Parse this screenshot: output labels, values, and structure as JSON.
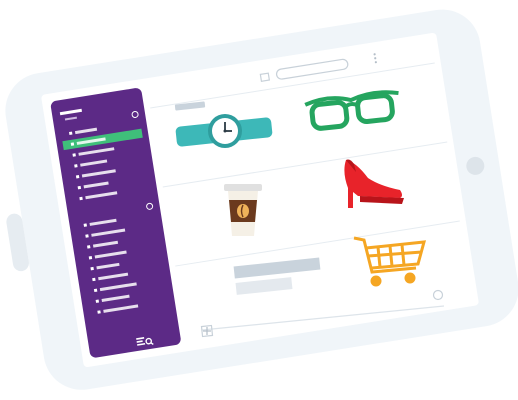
{
  "device": {
    "frame_color": "#f0f5f9",
    "screen_color": "#ffffff",
    "camera_color": "#dde4ea",
    "side_button_color": "#e6ecf1"
  },
  "sidebar": {
    "color": "#5c2a86",
    "active_color": "#3fbf7a",
    "item_color": "#ffffff",
    "sections": [
      {
        "items": 7,
        "active_index": 1
      },
      {
        "items": 9,
        "active_index": -1
      }
    ],
    "footer_icon": "search-list-icon"
  },
  "toolbar": {
    "icons": [
      "compose-icon",
      "search-input",
      "more-icon"
    ]
  },
  "grid": {
    "items": [
      {
        "name": "watch-icon",
        "color": "#3db8b8"
      },
      {
        "name": "glasses-icon",
        "color": "#25a55f"
      },
      {
        "name": "coffee-cup-icon",
        "color": "#6b3a1e"
      },
      {
        "name": "high-heel-icon",
        "color": "#e8232a"
      },
      {
        "name": "placeholder-card",
        "color": "#c9d3dc"
      },
      {
        "name": "shopping-cart-icon",
        "color": "#f5a623"
      }
    ]
  },
  "composer": {
    "add_icon": "plus-icon",
    "emoji_icon": "smiley-icon"
  }
}
